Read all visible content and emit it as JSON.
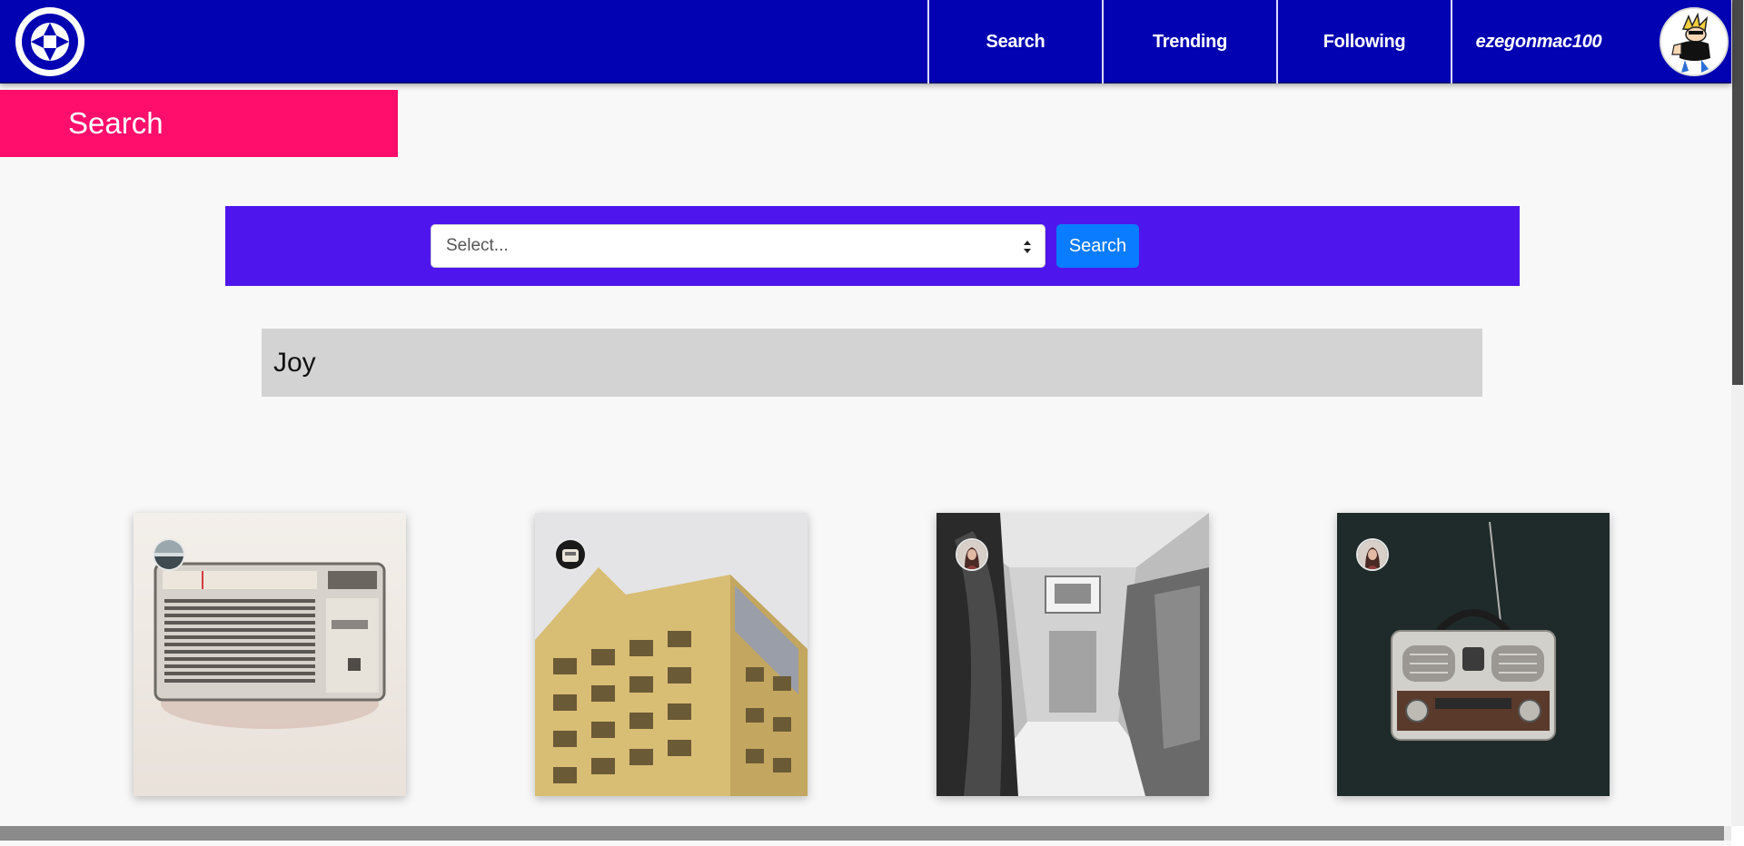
{
  "navbar": {
    "logo_icon": "camera-aperture-icon",
    "links": [
      {
        "label": "Search"
      },
      {
        "label": "Trending"
      },
      {
        "label": "Following"
      },
      {
        "label": "ezegonmac100"
      }
    ],
    "avatar_icon": "cartoon-character-avatar",
    "background": "#0202b2"
  },
  "page": {
    "title": "Search",
    "title_color": "#ff0f6b"
  },
  "search": {
    "select_placeholder": "Select...",
    "button_label": "Search",
    "panel_color": "#4e16ed",
    "button_color": "#0a7cff"
  },
  "results": {
    "tag": "Joy",
    "photos": [
      {
        "subject": "vintage-radio-photo",
        "user_avatar": "landscape-avatar"
      },
      {
        "subject": "yellow-building-photo",
        "user_avatar": "object-avatar"
      },
      {
        "subject": "train-interior-photo",
        "user_avatar": "woman-portrait-avatar"
      },
      {
        "subject": "retro-radio-dark-photo",
        "user_avatar": "woman-portrait-avatar"
      }
    ]
  }
}
